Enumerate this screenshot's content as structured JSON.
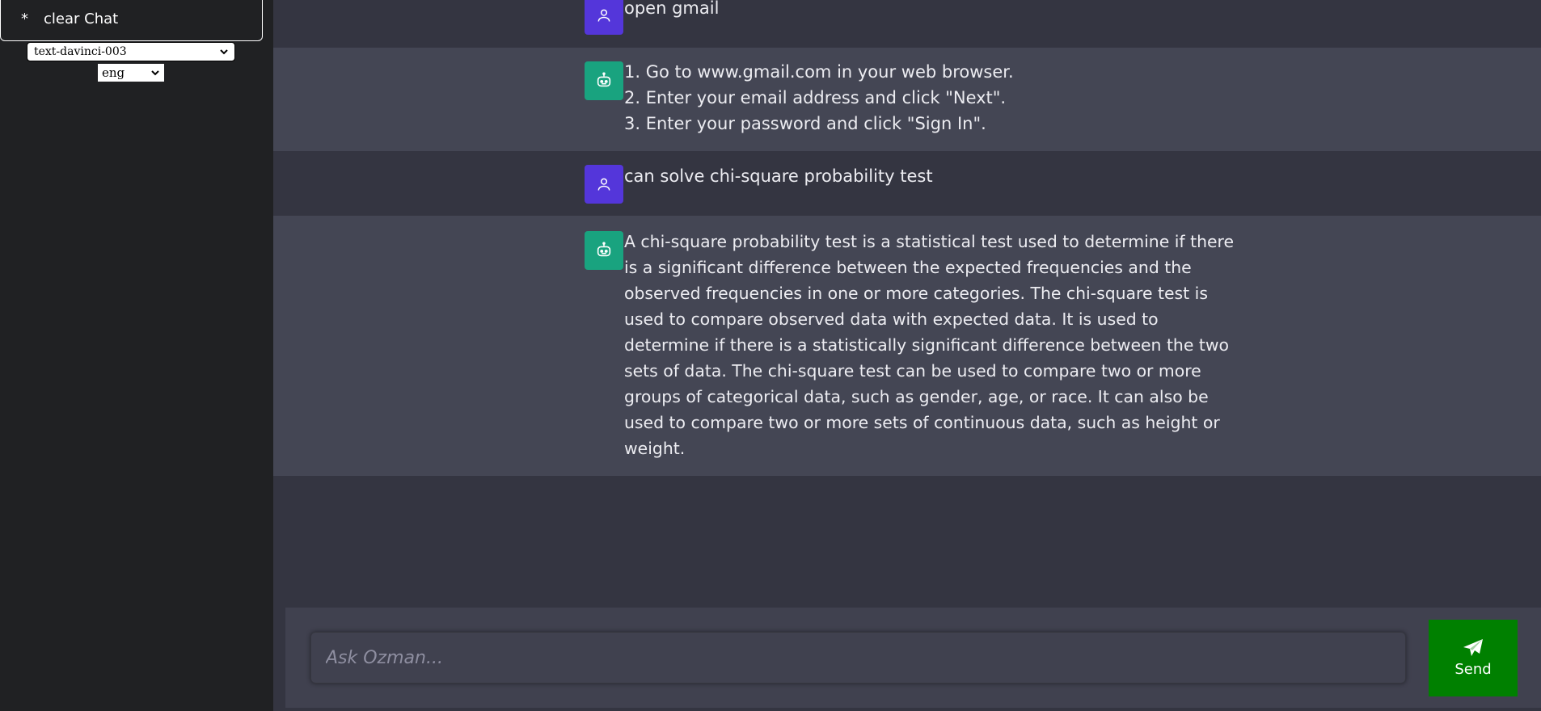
{
  "sidebar": {
    "clear_chat_star": "*",
    "clear_chat_label": "clear Chat",
    "model_select_value": "text-davinci-003",
    "lang_select_value": "eng"
  },
  "messages": [
    {
      "role": "user",
      "text": "open gmail"
    },
    {
      "role": "bot",
      "text": "1. Go to www.gmail.com in your web browser.\n2. Enter your email address and click \"Next\".\n3. Enter your password and click \"Sign In\"."
    },
    {
      "role": "user",
      "text": "can solve chi-square probability test"
    },
    {
      "role": "bot",
      "text": "A chi-square probability test is a statistical test used to determine if there is a significant difference between the expected frequencies and the observed frequencies in one or more categories. The chi-square test is used to compare observed data with expected data. It is used to determine if there is a statistically significant difference between the two sets of data. The chi-square test can be used to compare two or more groups of categorical data, such as gender, age, or race. It can also be used to compare two or more sets of continuous data, such as height or weight."
    }
  ],
  "composer": {
    "placeholder": "Ask Ozman...",
    "send_label": "Send"
  },
  "colors": {
    "sidebar_bg": "#202123",
    "chat_bg": "#343541",
    "bot_bg": "#444654",
    "user_avatar": "#5436da",
    "bot_avatar": "#19a37f",
    "send_button": "#008000"
  },
  "icons": {
    "user_avatar": "user-icon",
    "bot_avatar": "robot-icon",
    "send": "paper-plane-icon",
    "dropdown": "chevron-down-icon"
  }
}
